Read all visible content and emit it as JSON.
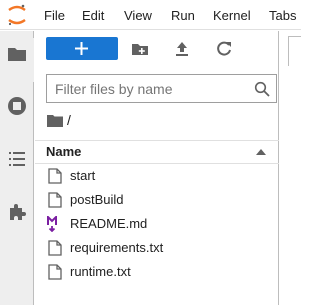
{
  "menubar": {
    "logo": "jupyter-logo",
    "items": [
      "File",
      "Edit",
      "View",
      "Run",
      "Kernel",
      "Tabs"
    ]
  },
  "activitybar": {
    "icons": [
      "folder-icon",
      "running-icon",
      "table-of-contents-icon",
      "extension-icon"
    ]
  },
  "filebrowser": {
    "new_launcher_icon": "plus-icon",
    "toolbar_icons": [
      "new-folder-icon",
      "upload-icon",
      "refresh-icon"
    ],
    "filter_placeholder": "Filter files by name",
    "filter_value": "",
    "breadcrumb_root": "/",
    "column_name": "Name",
    "files": [
      {
        "name": "start",
        "icon": "file-icon"
      },
      {
        "name": "postBuild",
        "icon": "file-icon"
      },
      {
        "name": "README.md",
        "icon": "markdown-icon"
      },
      {
        "name": "requirements.txt",
        "icon": "file-icon"
      },
      {
        "name": "runtime.txt",
        "icon": "file-icon"
      }
    ]
  },
  "colors": {
    "accent": "#1976d2",
    "logo_orange": "#f37726",
    "markdown_purple": "#7b1fa2",
    "icon_gray": "#616161"
  }
}
